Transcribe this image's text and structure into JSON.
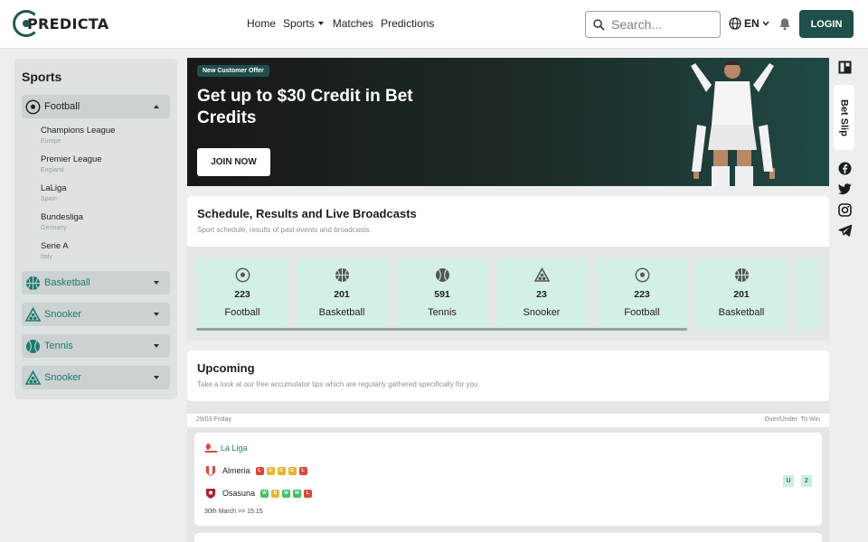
{
  "header": {
    "logo_text": "PREDICTA",
    "nav": [
      {
        "label": "Home"
      },
      {
        "label": "Sports"
      },
      {
        "label": "Matches"
      },
      {
        "label": "Predictions"
      }
    ],
    "search_placeholder": "Search...",
    "language": "EN",
    "login_label": "LOGIN"
  },
  "sidebar": {
    "title": "Sports",
    "groups": [
      {
        "label": "Football",
        "icon": "football-icon",
        "expanded": true
      },
      {
        "label": "Basketball",
        "icon": "basketball-icon",
        "expanded": false
      },
      {
        "label": "Snooker",
        "icon": "snooker-icon",
        "expanded": false
      },
      {
        "label": "Tennis",
        "icon": "tennis-icon",
        "expanded": false
      },
      {
        "label": "Snooker",
        "icon": "snooker-icon",
        "expanded": false
      }
    ],
    "leagues": [
      {
        "name": "Champions League",
        "country": "Europe"
      },
      {
        "name": "Premier League",
        "country": "England"
      },
      {
        "name": "LaLiga",
        "country": "Spain"
      },
      {
        "name": "Bundesliga",
        "country": "Germany"
      },
      {
        "name": "Serie A",
        "country": "Italy"
      }
    ]
  },
  "hero": {
    "badge": "New Customer Offer",
    "headline": "Get up to $30 Credit in Bet Credits",
    "cta": "JOIN NOW"
  },
  "schedule": {
    "title": "Schedule, Results and Live Broadcasts",
    "subtitle": "Sport schedule, results of past events and broadcasts.",
    "tiles": [
      {
        "count": "223",
        "label": "Football",
        "icon": "football-icon"
      },
      {
        "count": "201",
        "label": "Basketball",
        "icon": "basketball-icon"
      },
      {
        "count": "591",
        "label": "Tennis",
        "icon": "tennis-icon"
      },
      {
        "count": "23",
        "label": "Snooker",
        "icon": "snooker-icon"
      },
      {
        "count": "223",
        "label": "Football",
        "icon": "football-icon"
      },
      {
        "count": "201",
        "label": "Basketball",
        "icon": "basketball-icon"
      }
    ]
  },
  "upcoming": {
    "title": "Upcoming",
    "subtitle": "Take a look at our free accumulator tips which are regularly gathered specifically for you.",
    "date": "29/03 Friday",
    "columns": "Over/Under  To Win",
    "match": {
      "league": "La Liga",
      "home": {
        "name": "Almeria",
        "form": [
          "L",
          "D",
          "D",
          "D",
          "L"
        ]
      },
      "away": {
        "name": "Osasuna",
        "form": [
          "W",
          "D",
          "W",
          "W",
          "L"
        ]
      },
      "time": "30th March >> 15:15",
      "odds": [
        "U",
        "2"
      ]
    }
  },
  "rail": {
    "bet_slip": "Bet Slip",
    "socials": [
      "facebook-icon",
      "twitter-icon",
      "instagram-icon",
      "telegram-icon"
    ]
  },
  "colors": {
    "brand": "#1f4f4a",
    "accent_teal": "#1b7d70",
    "tile_bg": "#d3efe9",
    "form_loss": "#e0453c",
    "form_draw": "#e8b52d",
    "form_win": "#3fc06a"
  }
}
